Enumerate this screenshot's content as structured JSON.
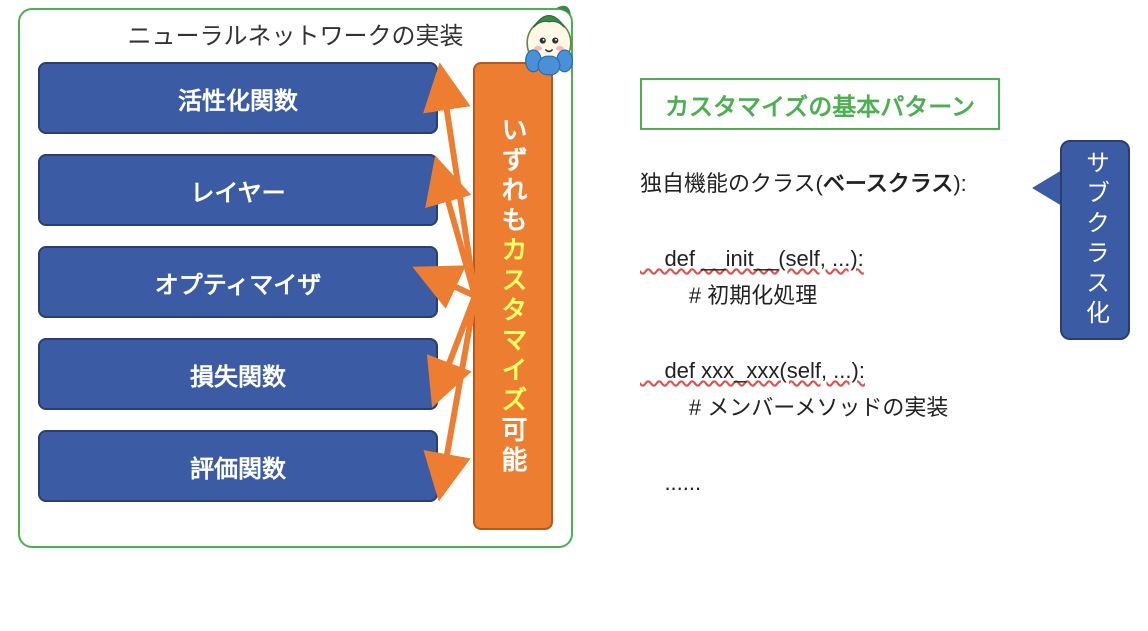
{
  "left": {
    "title": "ニューラルネットワークの実装",
    "items": [
      "活性化関数",
      "レイヤー",
      "オプティマイザ",
      "損失関数",
      "評価関数"
    ],
    "pillar_pre": "いずれも",
    "pillar_highlight": "カスタマイズ",
    "pillar_post": "可能"
  },
  "right": {
    "title": "カスタマイズの基本パターン",
    "code": {
      "l1_pre": "独自機能のクラス(",
      "l1_bold": "ベースクラス",
      "l1_post": "):",
      "l2": "    def __init__(self, ...):",
      "l3": "        # 初期化処理",
      "l4": "    def xxx_xxx(self, ...):",
      "l5": "        # メンバーメソッドの実装",
      "l6": "    ......"
    },
    "callout": "サブクラス化"
  }
}
